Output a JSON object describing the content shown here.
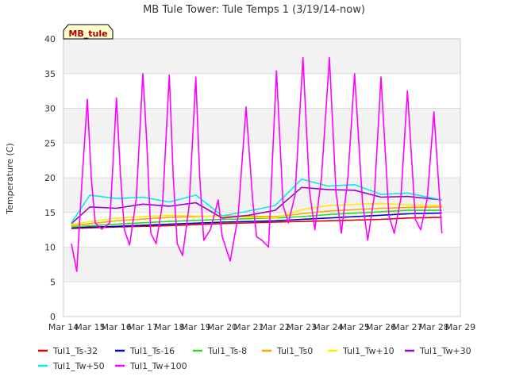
{
  "chart_data": {
    "type": "line",
    "title": "MB Tule Tower: Tule Temps 1 (3/19/14-now)",
    "station_badge": "MB_tule",
    "xlabel": "",
    "ylabel": "Temperature (C)",
    "xlim": [
      "Mar 14",
      "Mar 29"
    ],
    "ylim": [
      0,
      40
    ],
    "x_ticks": [
      "Mar 14",
      "Mar 15",
      "Mar 16",
      "Mar 17",
      "Mar 18",
      "Mar 19",
      "Mar 20",
      "Mar 21",
      "Mar 22",
      "Mar 23",
      "Mar 24",
      "Mar 25",
      "Mar 26",
      "Mar 27",
      "Mar 28",
      "Mar 29"
    ],
    "y_ticks": [
      0,
      5,
      10,
      15,
      20,
      25,
      30,
      35,
      40
    ],
    "grid": "horizontal bands",
    "legend_position": "bottom",
    "x_unit": "days (0 = Mar 14)",
    "series": [
      {
        "name": "Tul1_Ts-32",
        "color": "#dd0000",
        "x": [
          0.3,
          2,
          4,
          6,
          8,
          9,
          10,
          12,
          13,
          14.3
        ],
        "y": [
          12.7,
          12.9,
          13.1,
          13.4,
          13.6,
          13.7,
          13.8,
          14.0,
          14.2,
          14.3
        ]
      },
      {
        "name": "Tul1_Ts-16",
        "color": "#0000cc",
        "x": [
          0.3,
          2,
          4,
          6,
          8,
          9,
          10,
          12,
          13,
          14.3
        ],
        "y": [
          12.8,
          13.0,
          13.3,
          13.6,
          13.8,
          14.0,
          14.2,
          14.6,
          14.8,
          14.9
        ]
      },
      {
        "name": "Tul1_Ts-8",
        "color": "#22dd22",
        "x": [
          0.3,
          2,
          4,
          6,
          8,
          9,
          10,
          12,
          13,
          14.3
        ],
        "y": [
          12.9,
          13.3,
          13.7,
          14.0,
          14.2,
          14.4,
          14.7,
          15.1,
          15.3,
          15.3
        ]
      },
      {
        "name": "Tul1_Ts0",
        "color": "#ffa500",
        "x": [
          0.3,
          2,
          4,
          6,
          8,
          9,
          10,
          12,
          13,
          14.3
        ],
        "y": [
          13.1,
          13.8,
          14.3,
          14.5,
          14.4,
          14.8,
          15.2,
          15.6,
          15.7,
          15.8
        ]
      },
      {
        "name": "Tul1_Tw+10",
        "color": "#ffee00",
        "x": [
          0.3,
          2,
          4,
          6,
          8,
          9,
          10,
          12,
          13,
          14.3
        ],
        "y": [
          13.3,
          14.2,
          14.6,
          14.4,
          14.2,
          15.4,
          16.0,
          16.3,
          16.1,
          16.0
        ]
      },
      {
        "name": "Tul1_Tw+30",
        "color": "#9900cc",
        "x": [
          0.3,
          1,
          2,
          3,
          4,
          5,
          6,
          7,
          8,
          9,
          10,
          11,
          12,
          13,
          14.3
        ],
        "y": [
          13.4,
          15.8,
          15.6,
          16.2,
          15.9,
          16.4,
          14.2,
          14.6,
          15.3,
          18.6,
          18.3,
          18.2,
          17.2,
          17.3,
          16.8
        ]
      },
      {
        "name": "Tul1_Tw+50",
        "color": "#00eeee",
        "x": [
          0.3,
          1,
          2,
          3,
          4,
          5,
          6,
          7,
          8,
          9,
          10,
          11,
          12,
          13,
          14.3
        ],
        "y": [
          13.5,
          17.5,
          17.0,
          17.2,
          16.5,
          17.5,
          14.5,
          15.2,
          16.0,
          19.8,
          18.8,
          19.0,
          17.6,
          17.8,
          16.8
        ]
      },
      {
        "name": "Tul1_Tw+100",
        "color": "#ff00ff",
        "x": [
          0.3,
          0.5,
          0.7,
          0.9,
          1.05,
          1.2,
          1.45,
          1.75,
          2.0,
          2.15,
          2.3,
          2.5,
          2.75,
          3.0,
          3.15,
          3.3,
          3.5,
          3.75,
          4.0,
          4.15,
          4.3,
          4.5,
          4.75,
          5.0,
          5.15,
          5.3,
          5.55,
          5.85,
          6.0,
          6.3,
          6.6,
          6.9,
          7.15,
          7.3,
          7.5,
          7.75,
          8.05,
          8.3,
          8.5,
          8.75,
          9.05,
          9.3,
          9.5,
          9.75,
          10.05,
          10.3,
          10.5,
          10.75,
          11.0,
          11.3,
          11.5,
          11.75,
          12.0,
          12.3,
          12.5,
          12.75,
          13.0,
          13.3,
          13.5,
          13.75,
          14.0,
          14.3
        ],
        "y": [
          10.5,
          6.5,
          19.5,
          31.3,
          20.0,
          13.5,
          12.6,
          13.5,
          31.5,
          20.5,
          12.5,
          10.3,
          17.0,
          35.0,
          25.0,
          12.0,
          10.5,
          16.5,
          34.8,
          20.0,
          10.5,
          8.8,
          16.0,
          34.5,
          20.0,
          11.0,
          12.5,
          16.8,
          11.5,
          8.0,
          14.5,
          30.2,
          16.8,
          11.5,
          11.0,
          10.0,
          35.4,
          16.0,
          13.5,
          17.5,
          37.3,
          18.0,
          12.5,
          20.0,
          37.3,
          18.0,
          12.0,
          20.0,
          35.0,
          16.5,
          11.0,
          17.5,
          34.5,
          14.5,
          12.0,
          17.0,
          32.5,
          14.0,
          12.5,
          17.0,
          29.5,
          12.0
        ]
      }
    ]
  }
}
